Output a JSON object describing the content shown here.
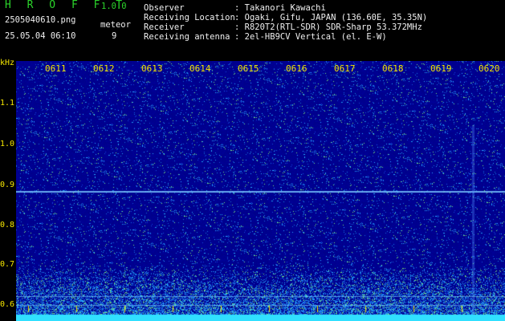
{
  "header": {
    "app_title": "H R O F F T",
    "version": "1.0.0",
    "filename": "2505040610.png",
    "datetime": "25.05.04 06:10",
    "meteor_label": "meteor",
    "meteor_count": "9"
  },
  "info": {
    "rows": [
      {
        "label": "Observer",
        "value": ": Takanori Kawachi"
      },
      {
        "label": "Receiving Location",
        "value": ": Ogaki, Gifu, JAPAN (136.60E, 35.35N)"
      },
      {
        "label": "Receiver",
        "value": ": R820T2(RTL-SDR) SDR-Sharp 53.372MHz"
      },
      {
        "label": "Receiving antenna",
        "value": ": 2el-HB9CV Vertical (el. E-W)"
      }
    ]
  },
  "axis": {
    "unit": "kHz",
    "y_ticks": [
      "1.1",
      "1.0",
      "0.9",
      "0.8",
      "0.7",
      "0.6"
    ],
    "x_ticks": [
      "0611",
      "0612",
      "0613",
      "0614",
      "0615",
      "0616",
      "0617",
      "0618",
      "0619",
      "0620"
    ]
  },
  "colors": {
    "background": "#000000",
    "spectrogram_bg": "#00008a",
    "axis_text": "#f5e600",
    "title_green": "#2bd42b",
    "signal_cyan": "#30e0ff"
  }
}
